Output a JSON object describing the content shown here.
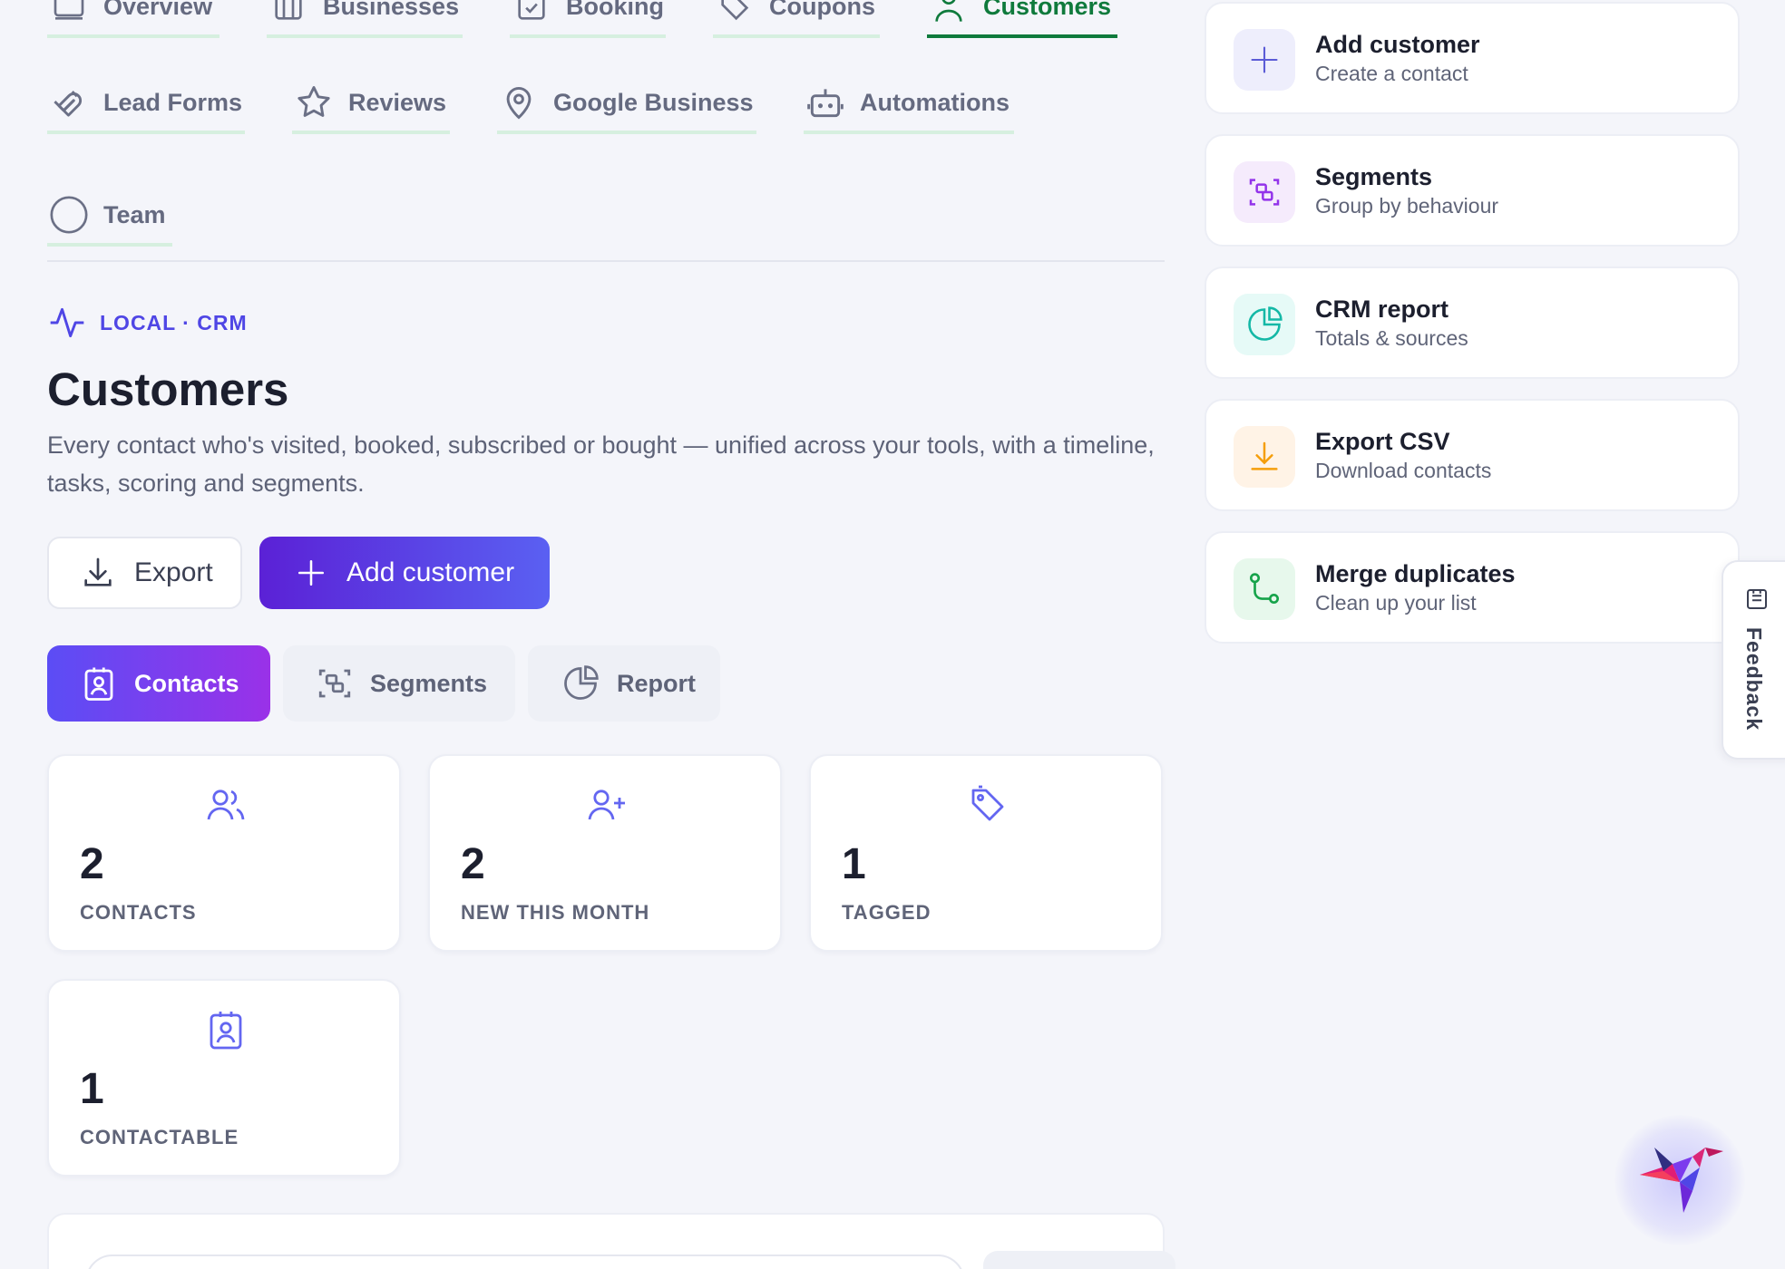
{
  "nav": {
    "row1": [
      {
        "label": "Overview",
        "icon": "overview-icon"
      },
      {
        "label": "Businesses",
        "icon": "businesses-icon"
      },
      {
        "label": "Booking",
        "icon": "booking-icon"
      },
      {
        "label": "Coupons",
        "icon": "coupon-icon"
      },
      {
        "label": "Customers",
        "icon": "customers-icon",
        "active": true
      }
    ],
    "row2": [
      {
        "label": "Lead Forms",
        "icon": "magnet-icon"
      },
      {
        "label": "Reviews",
        "icon": "star-icon"
      },
      {
        "label": "Google Business",
        "icon": "map-pin-icon"
      },
      {
        "label": "Automations",
        "icon": "robot-icon"
      }
    ],
    "row3": [
      {
        "label": "Team",
        "icon": "circle-icon"
      }
    ]
  },
  "header": {
    "eyebrow": "LOCAL · CRM",
    "title": "Customers",
    "description": "Every contact who's visited, booked, subscribed or bought — unified across your tools, with a timeline, tasks, scoring and segments."
  },
  "actions": {
    "export_label": "Export",
    "add_label": "Add customer"
  },
  "tabs": [
    {
      "label": "Contacts",
      "icon": "contact-card-icon",
      "active": true
    },
    {
      "label": "Segments",
      "icon": "segments-icon"
    },
    {
      "label": "Report",
      "icon": "pie-chart-icon"
    }
  ],
  "stats": [
    {
      "value": "2",
      "label": "CONTACTS",
      "icon": "users-icon"
    },
    {
      "value": "2",
      "label": "NEW THIS MONTH",
      "icon": "user-plus-icon"
    },
    {
      "value": "1",
      "label": "TAGGED",
      "icon": "tag-icon"
    },
    {
      "value": "1",
      "label": "CONTACTABLE",
      "icon": "contact-card-icon"
    }
  ],
  "quick_actions": [
    {
      "title": "Add customer",
      "subtitle": "Create a contact",
      "icon": "plus-icon",
      "color": "#5b5bd6",
      "bg": "#eeeefc"
    },
    {
      "title": "Segments",
      "subtitle": "Group by behaviour",
      "icon": "segments-icon",
      "color": "#9333ea",
      "bg": "#f5ebfc"
    },
    {
      "title": "CRM report",
      "subtitle": "Totals & sources",
      "icon": "pie-chart-icon",
      "color": "#14b8a6",
      "bg": "#e6faf7"
    },
    {
      "title": "Export CSV",
      "subtitle": "Download contacts",
      "icon": "download-icon",
      "color": "#f59e0b",
      "bg": "#fff3e6"
    },
    {
      "title": "Merge duplicates",
      "subtitle": "Clean up your list",
      "icon": "merge-icon",
      "color": "#16a34a",
      "bg": "#e7f8ec"
    }
  ],
  "feedback_label": "Feedback",
  "colors": {
    "accent": "#4f46e5",
    "active_nav": "#0f7a3c",
    "nav_underline": "#d6efdf"
  }
}
